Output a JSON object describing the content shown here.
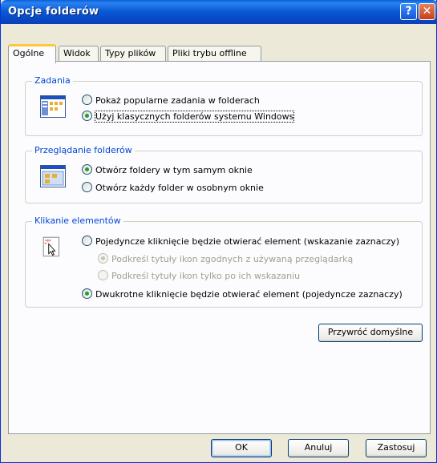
{
  "window": {
    "title": "Opcje folderów",
    "help_button": "?",
    "close_button": "✕"
  },
  "tabs": [
    {
      "label": "Ogólne",
      "active": true
    },
    {
      "label": "Widok",
      "active": false
    },
    {
      "label": "Typy plików",
      "active": false
    },
    {
      "label": "Pliki trybu offline",
      "active": false
    }
  ],
  "groups": {
    "tasks": {
      "label": "Zadania",
      "options": [
        {
          "label": "Pokaż popularne zadania w folderach",
          "checked": false
        },
        {
          "label": "Użyj klasycznych folderów systemu Windows",
          "checked": true
        }
      ]
    },
    "browse": {
      "label": "Przeglądanie folderów",
      "options": [
        {
          "label": "Otwórz foldery w tym samym oknie",
          "checked": true
        },
        {
          "label": "Otwórz każdy folder w osobnym oknie",
          "checked": false
        }
      ]
    },
    "click": {
      "label": "Klikanie elementów",
      "options": [
        {
          "label": "Pojedyncze kliknięcie będzie otwierać element (wskazanie zaznaczy)",
          "checked": false
        },
        {
          "label": "Podkreśl tytuły ikon zgodnych z używaną przeglądarką",
          "checked": true,
          "disabled": true
        },
        {
          "label": "Podkreśl tytuły ikon tylko po ich wskazaniu",
          "checked": false,
          "disabled": true
        },
        {
          "label": "Dwukrotne kliknięcie będzie otwierać element (pojedyncze zaznaczy)",
          "checked": true
        }
      ]
    }
  },
  "buttons": {
    "restore_defaults": "Przywróć domyślne",
    "ok": "OK",
    "cancel": "Anuluj",
    "apply": "Zastosuj"
  },
  "colors": {
    "title_bar": "#0a5bd6",
    "group_label": "#0046d5",
    "radio_dot": "#21a121",
    "active_tab_accent": "#ffc83c"
  }
}
